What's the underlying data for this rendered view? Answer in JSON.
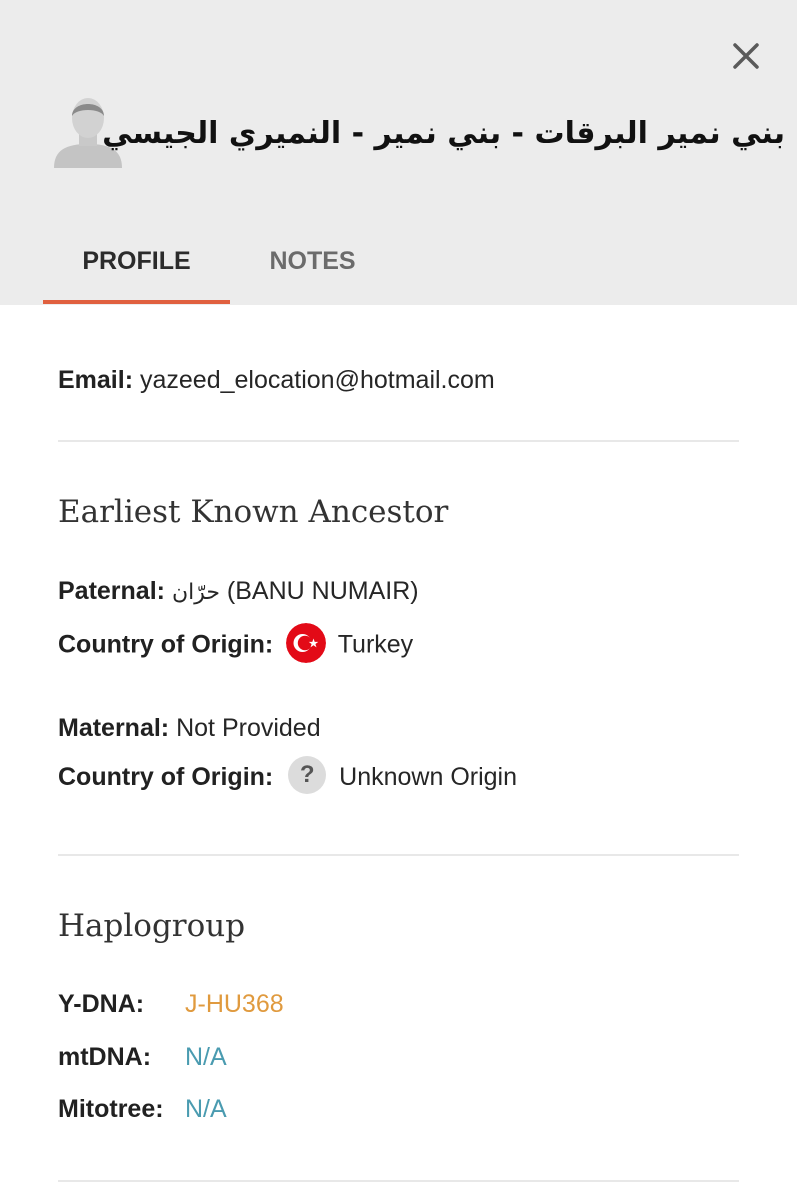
{
  "profile": {
    "name": "بني نمير البرقات - بني نمير - النميري الجيسي"
  },
  "tabs": [
    {
      "label": "PROFILE",
      "active": true
    },
    {
      "label": "NOTES",
      "active": false
    }
  ],
  "email": {
    "label": "Email:",
    "value": "yazeed_elocation@hotmail.com"
  },
  "ancestor": {
    "title": "Earliest Known Ancestor",
    "paternal_label": "Paternal:",
    "paternal_arabic": "حرّان",
    "paternal_value": "(BANU NUMAIR)",
    "paternal_country_label": "Country of Origin:",
    "paternal_country": "Turkey",
    "paternal_flag_icon": "turkey-flag",
    "maternal_label": "Maternal:",
    "maternal_value": "Not Provided",
    "maternal_country_label": "Country of Origin:",
    "maternal_country_icon": "?",
    "maternal_country": "Unknown Origin"
  },
  "haplogroup": {
    "title": "Haplogroup",
    "ydna_label": "Y-DNA:",
    "ydna_value": "J-HU368",
    "mtdna_label": "mtDNA:",
    "mtdna_value": "N/A",
    "mitotree_label": "Mitotree:",
    "mitotree_value": "N/A"
  },
  "colors": {
    "header_bg": "#ececec",
    "tab_accent": "#e0603f",
    "ydna": "#e09a3e",
    "link": "#4a9bb0",
    "flag_red": "#e30a17"
  }
}
